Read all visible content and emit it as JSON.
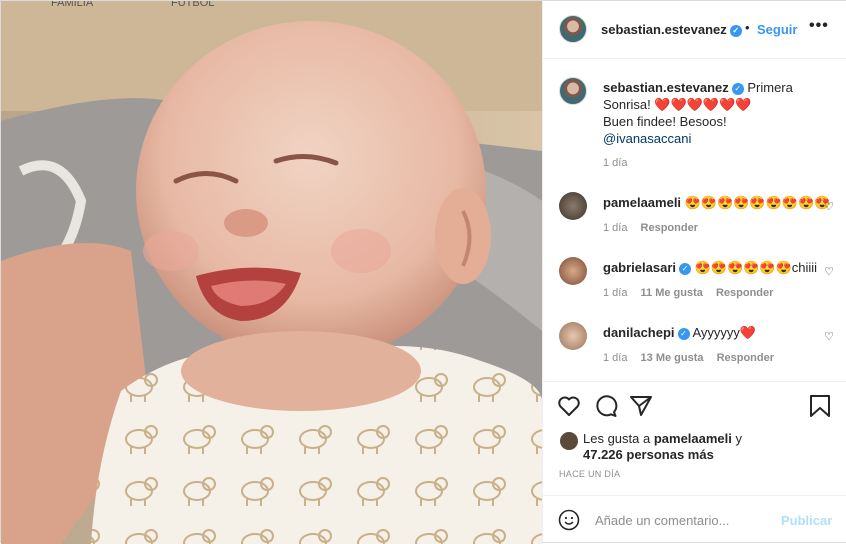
{
  "photo": {
    "top_labels": [
      "FAMILIA",
      "FUTBOL"
    ]
  },
  "header": {
    "username": "sebastian.estevanez",
    "separator": "•",
    "follow_label": "Seguir",
    "more_label": "•••"
  },
  "caption": {
    "username": "sebastian.estevanez",
    "line1": "Primera",
    "line2": "Sonrisa! ❤️❤️❤️❤️❤️❤️",
    "line3": "Buen findee! Besoos!",
    "mention": "@ivanasaccani",
    "time": "1 día"
  },
  "comments": [
    {
      "username": "pamelaameli",
      "text": "😍😍😍😍😍😍😍😍😍",
      "time": "1 día",
      "likes": "",
      "reply": "Responder",
      "verified": false
    },
    {
      "username": "gabrielasari",
      "text": "😍😍😍😍😍😍chiiii",
      "time": "1 día",
      "likes": "11 Me gusta",
      "reply": "Responder",
      "verified": true
    },
    {
      "username": "danilachepi",
      "text": "Ayyyyyy❤️",
      "time": "1 día",
      "likes": "13 Me gusta",
      "reply": "Responder",
      "verified": true
    }
  ],
  "likes": {
    "prefix": "Les gusta a",
    "user": "pamelaameli",
    "connector": "y",
    "count": "47.226 personas más"
  },
  "posted_ago": "HACE UN DÍA",
  "add_comment": {
    "placeholder": "Añade un comentario...",
    "post_label": "Publicar"
  },
  "icons": [
    "heart-icon",
    "comment-icon",
    "share-icon",
    "bookmark-icon",
    "emoji-icon"
  ],
  "colors": {
    "accent": "#3897f0",
    "text": "#262626",
    "muted": "#8e8e8e",
    "post_disabled": "#b2dffc"
  }
}
